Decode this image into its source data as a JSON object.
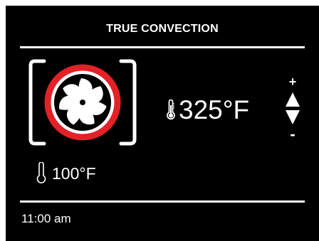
{
  "header": {
    "title": "TRUE CONVECTION"
  },
  "mode": {
    "icon": "convection-fan-icon",
    "accent_color": "#e32228"
  },
  "oven": {
    "icon": "thermometer-icon",
    "set_temperature": "325°F"
  },
  "probe": {
    "icon": "thermometer-icon",
    "temperature": "100°F"
  },
  "adjust": {
    "increase_label": "+",
    "decrease_label": "-",
    "icon": "up-down-arrows-icon"
  },
  "footer": {
    "time": "11:00 am"
  }
}
